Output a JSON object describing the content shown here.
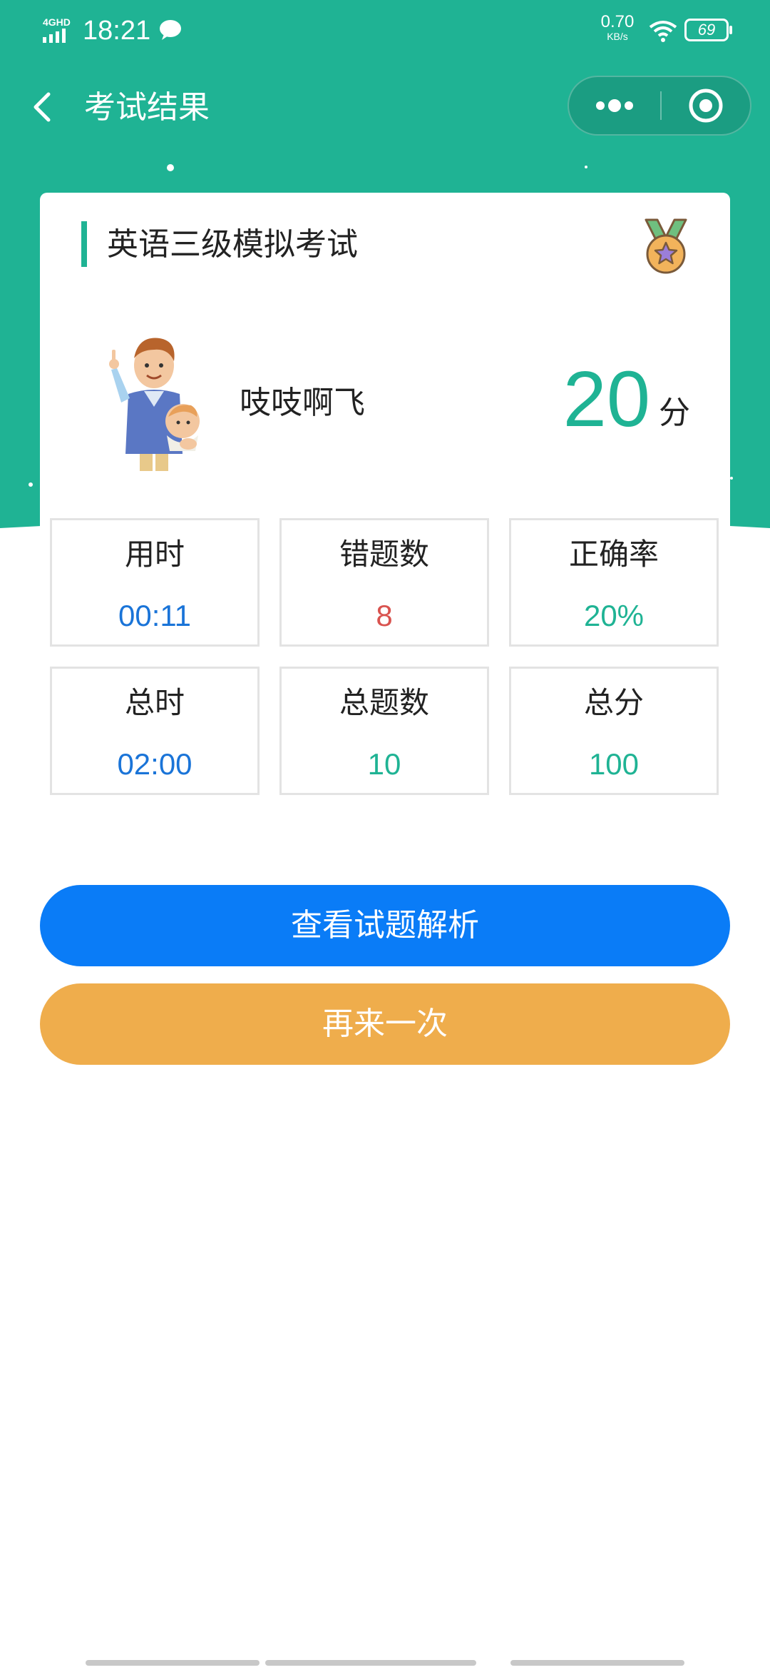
{
  "status_bar": {
    "network": "4GHD",
    "time": "18:21",
    "speed_value": "0.70",
    "speed_unit": "KB/s",
    "battery": "69"
  },
  "navbar": {
    "title": "考试结果"
  },
  "card": {
    "exam_title": "英语三级模拟考试",
    "username": "吱吱啊飞",
    "score": "20",
    "score_unit": "分"
  },
  "stats": [
    {
      "label": "用时",
      "value": "00:11",
      "color": "#1a74d8"
    },
    {
      "label": "错题数",
      "value": "8",
      "color": "#d9534f"
    },
    {
      "label": "正确率",
      "value": "20%",
      "color": "#1fb394"
    },
    {
      "label": "总时",
      "value": "02:00",
      "color": "#1a74d8"
    },
    {
      "label": "总题数",
      "value": "10",
      "color": "#1fb394"
    },
    {
      "label": "总分",
      "value": "100",
      "color": "#1fb394"
    }
  ],
  "buttons": {
    "analysis": "查看试题解析",
    "retry": "再来一次"
  },
  "colors": {
    "accent": "#1fb394",
    "primary_button": "#0a7cf7",
    "secondary_button": "#efad4c"
  },
  "icons": {
    "back": "chevron-left-icon",
    "more": "more-dots-icon",
    "close": "target-close-icon",
    "medal": "medal-icon"
  }
}
